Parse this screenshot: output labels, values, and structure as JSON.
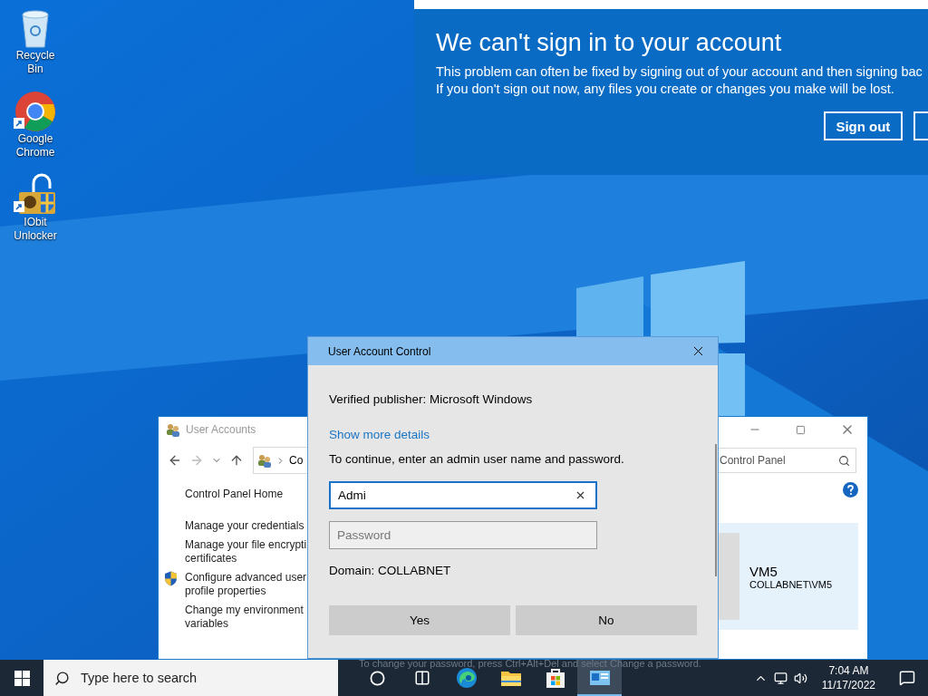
{
  "desktop": {
    "icons": [
      {
        "label": "Recycle Bin",
        "kind": "bin",
        "shortcut": false
      },
      {
        "label": "Google Chrome",
        "kind": "browser",
        "shortcut": true
      },
      {
        "label": "IObit Unlocker",
        "kind": "unlocker",
        "shortcut": true
      }
    ]
  },
  "notification": {
    "title": "We can't sign in to your account",
    "lines": [
      "This problem can often be fixed by signing out of your account and then signing bac",
      "If you don't sign out now, any files you create or changes you make will be lost."
    ],
    "button": "Sign out"
  },
  "control_panel": {
    "title": "User Accounts",
    "address": "Co",
    "search": "Control Panel",
    "links": [
      {
        "label": "Control Panel Home",
        "shield": false
      },
      {
        "label": "Manage your credentials",
        "shield": false
      },
      {
        "label": "Manage your file encrypti certificates",
        "shield": false
      },
      {
        "label": "Configure advanced user profile properties",
        "shield": true
      },
      {
        "label": "Change my environment variables",
        "shield": false
      }
    ],
    "account": {
      "name": "VM5",
      "detail": "COLLABNET\\VM5"
    }
  },
  "uac": {
    "title": "User Account Control",
    "publisher": "Verified publisher: Microsoft Windows",
    "details_link": "Show more details",
    "prompt": "To continue, enter an admin user name and password.",
    "username": {
      "value": "Admi",
      "focused": true
    },
    "password": {
      "placeholder": "Password",
      "focused": false
    },
    "domain": "Domain: COLLABNET",
    "buttons": [
      "Yes",
      "No"
    ]
  },
  "password_hint": "To change your password, press Ctrl+Alt+Del and select Change a password.",
  "taskbar": {
    "search_placeholder": "Type here to search",
    "apps": [
      {
        "kind": "cortana",
        "selected": false
      },
      {
        "kind": "task-view",
        "selected": false
      },
      {
        "kind": "edge",
        "selected": false
      },
      {
        "kind": "explorer",
        "selected": false
      },
      {
        "kind": "store",
        "selected": false
      },
      {
        "kind": "control-panel",
        "selected": true
      }
    ],
    "time": "7:04 AM",
    "date": "11/17/2022"
  }
}
